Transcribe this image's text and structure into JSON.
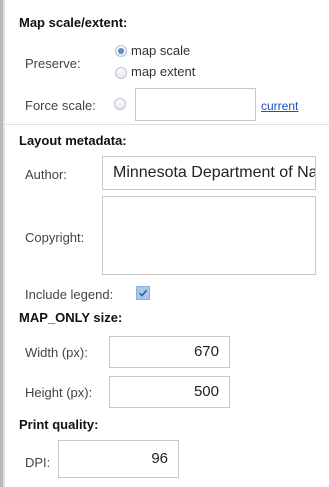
{
  "map_scale_extent": {
    "heading": "Map scale/extent:",
    "preserve_label": "Preserve:",
    "options": [
      {
        "label": "map scale",
        "selected": true
      },
      {
        "label": "map extent",
        "selected": false
      }
    ],
    "force_scale_label": "Force scale:",
    "force_scale_value": "",
    "current_link": "current"
  },
  "layout_metadata": {
    "heading": "Layout metadata:",
    "author_label": "Author:",
    "author_value": "Minnesota Department of Natural Resources",
    "copyright_label": "Copyright:",
    "copyright_value": "",
    "include_legend_label": "Include legend:",
    "include_legend_checked": true
  },
  "map_only_size": {
    "heading": "MAP_ONLY size:",
    "width_label": "Width (px):",
    "width_value": "670",
    "height_label": "Height (px):",
    "height_value": "500"
  },
  "print_quality": {
    "heading": "Print quality:",
    "dpi_label": "DPI:",
    "dpi_value": "96"
  },
  "colors": {
    "link": "#1a4fbf",
    "radio_selected": "#5b8fc6",
    "checkbox_fill": "#a9c8ea"
  }
}
